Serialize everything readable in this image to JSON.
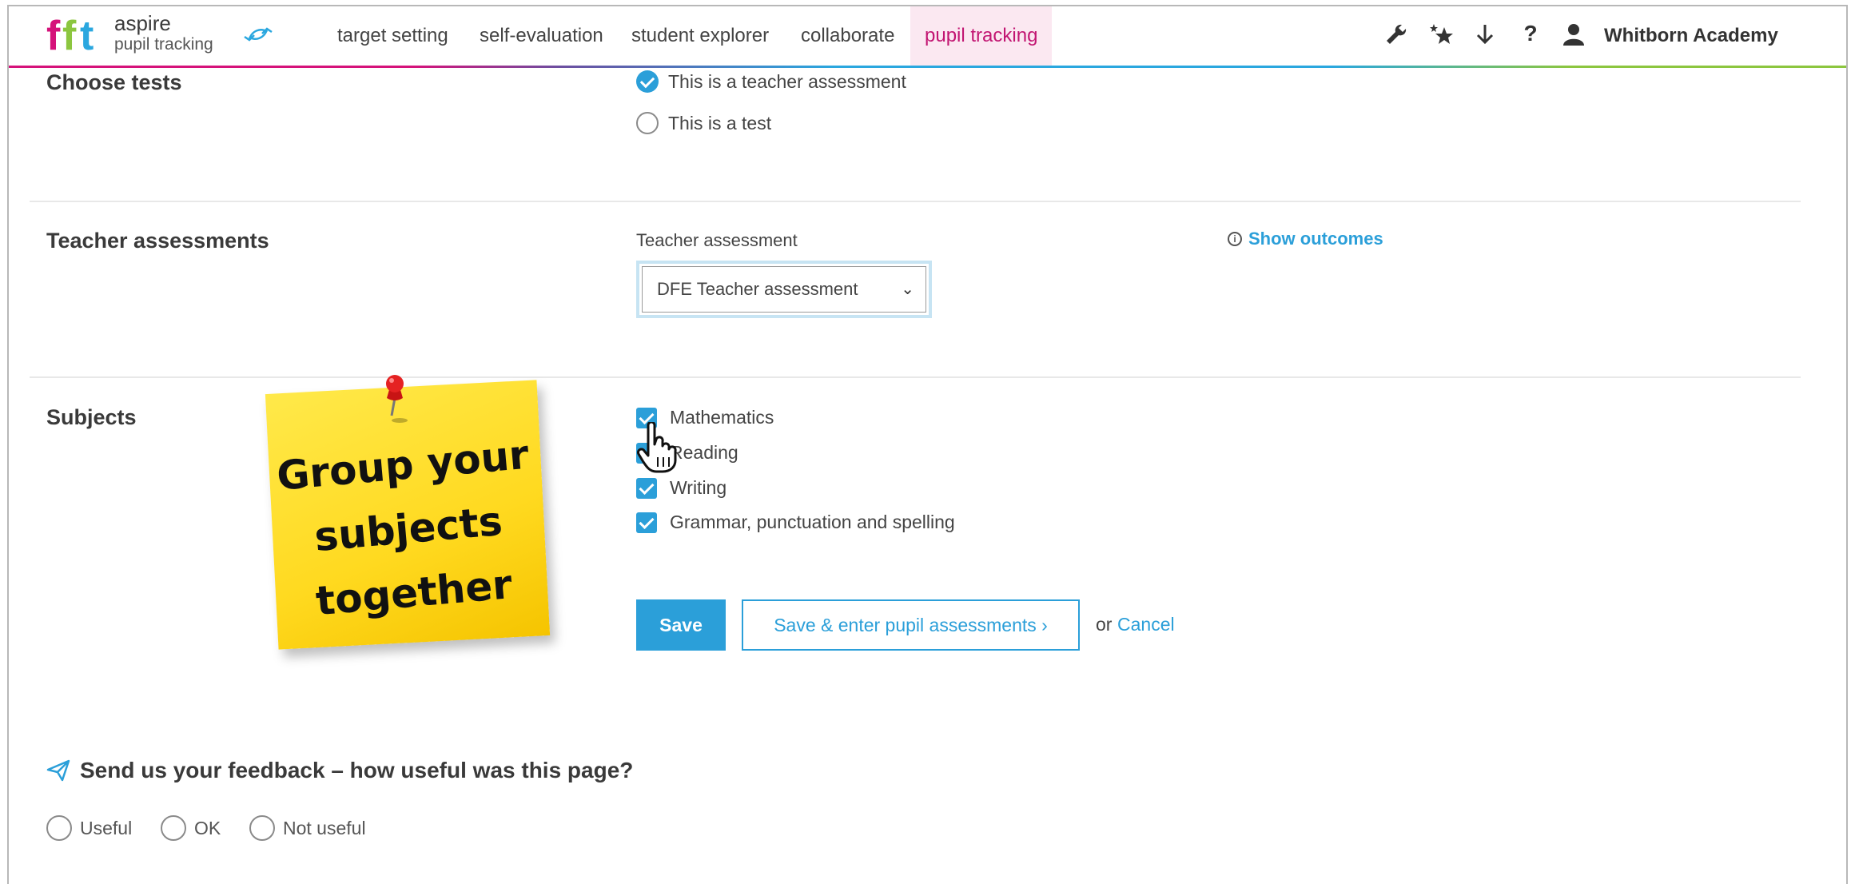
{
  "header": {
    "logo_word": "aspire",
    "logo_sub": "pupil tracking",
    "nav": [
      {
        "label": "target setting"
      },
      {
        "label": "self-evaluation"
      },
      {
        "label": "student explorer"
      },
      {
        "label": "collaborate"
      },
      {
        "label": "pupil tracking",
        "active": true
      }
    ],
    "icons": [
      "wrench-icon",
      "stars-icon",
      "download-icon",
      "help-icon",
      "user-icon"
    ],
    "help_label": "?",
    "org_name": "Whitborn Academy"
  },
  "choose_tests": {
    "title": "Choose tests",
    "options": [
      {
        "label": "This is a teacher assessment",
        "selected": true
      },
      {
        "label": "This is a test",
        "selected": false
      }
    ]
  },
  "teacher_assessments": {
    "title": "Teacher assessments",
    "field_label": "Teacher assessment",
    "select_value": "DFE Teacher assessment",
    "show_outcomes": "Show outcomes"
  },
  "subjects": {
    "title": "Subjects",
    "items": [
      {
        "label": "Mathematics",
        "checked": true
      },
      {
        "label": "Reading",
        "checked": true
      },
      {
        "label": "Writing",
        "checked": true
      },
      {
        "label": "Grammar, punctuation and spelling",
        "checked": true
      }
    ]
  },
  "actions": {
    "save": "Save",
    "save_enter": "Save & enter pupil assessments ›",
    "or": "or",
    "cancel": "Cancel"
  },
  "sticky_note": {
    "line1": "Group your",
    "line2": "subjects",
    "line3": "together"
  },
  "feedback": {
    "title": "Send us your feedback – how useful was this page?",
    "options": [
      "Useful",
      "OK",
      "Not useful"
    ]
  },
  "colors": {
    "accent": "#2b9fd9",
    "brand_pink": "#d5127a",
    "active_tab_bg": "#fbe8f1",
    "sticky_yellow": "#ffe94a"
  }
}
